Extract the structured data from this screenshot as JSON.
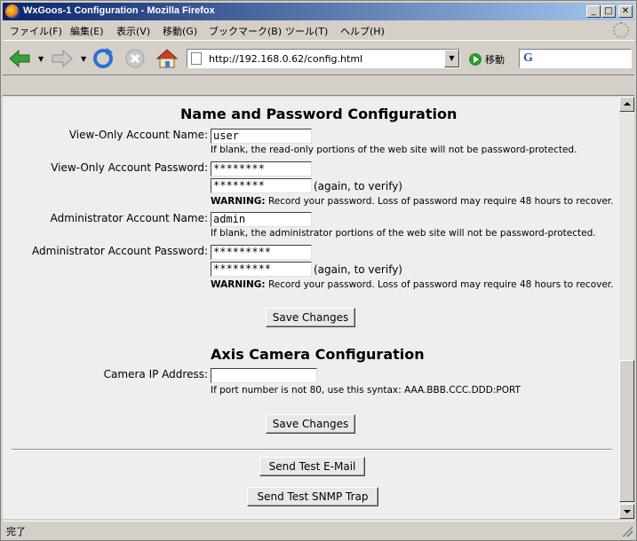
{
  "window": {
    "title": "WxGoos-1 Configuration - Mozilla Firefox",
    "min": "_",
    "max": "□",
    "close": "✕"
  },
  "menu": [
    "ファイル(F)",
    "編集(E)",
    "表示(V)",
    "移動(G)",
    "ブックマーク(B)",
    "ツール(T)",
    "ヘルプ(H)"
  ],
  "nav": {
    "url": "http://192.168.0.62/config.html",
    "go_label": "移動",
    "search_logo": "G"
  },
  "page": {
    "name_section": {
      "title": "Name and Password Configuration",
      "view_only_name_label": "View-Only Account Name:",
      "view_only_name_value": "user",
      "view_only_name_hint": "If blank, the read-only portions of the web site will not be password-protected.",
      "view_only_password_label": "View-Only Account Password:",
      "view_only_password_value": "********",
      "view_only_password_verify": "********",
      "again_text": "(again, to verify)",
      "warning_strong": "WARNING:",
      "warning_text": " Record your password. Loss of password may require 48 hours to recover.",
      "admin_name_label": "Administrator Account Name:",
      "admin_name_value": "admin",
      "admin_name_hint": "If blank, the administrator portions of the web site will not be password-protected.",
      "admin_password_label": "Administrator Account Password:",
      "admin_password_value": "*********",
      "admin_password_verify": "*********",
      "save_label": "Save Changes"
    },
    "camera_section": {
      "title": "Axis Camera Configuration",
      "ip_label": "Camera IP Address:",
      "ip_value": "",
      "ip_hint": "If port number is not 80, use this syntax: AAA.BBB.CCC.DDD:PORT",
      "save_label": "Save Changes"
    },
    "test_email_label": "Send Test E-Mail",
    "test_snmp_label": "Send Test SNMP Trap"
  },
  "status": {
    "text": "完了"
  }
}
